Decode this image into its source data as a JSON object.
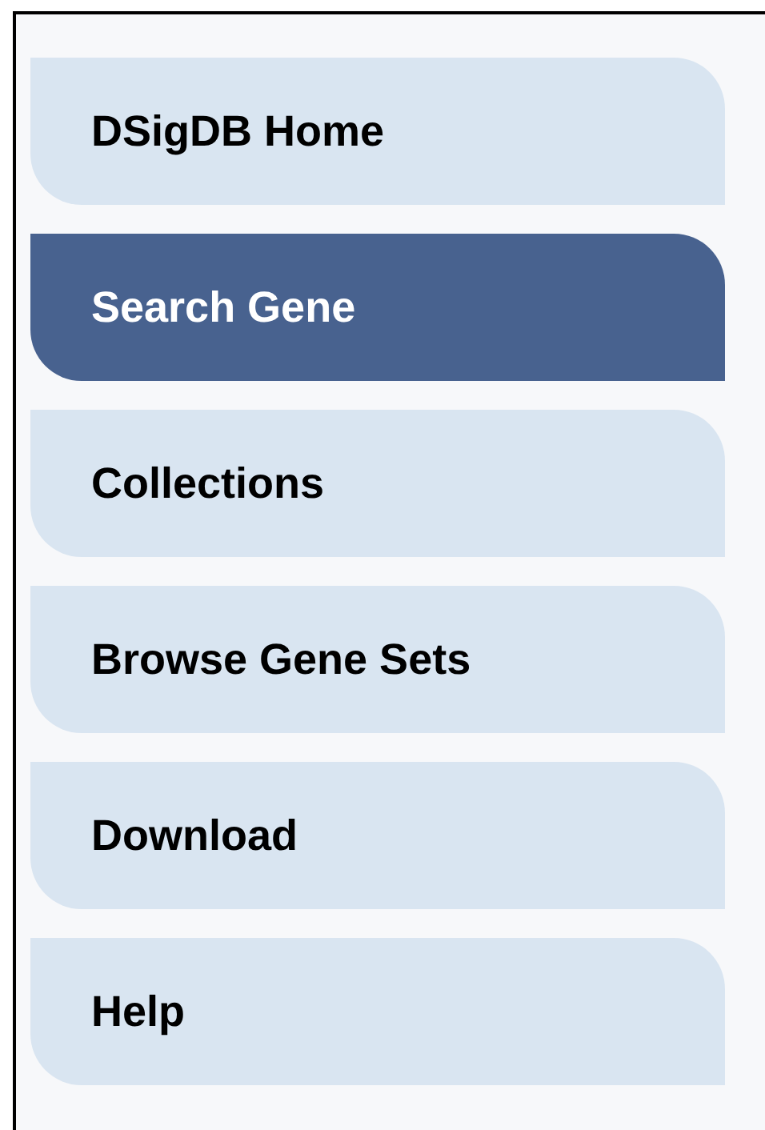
{
  "nav": {
    "items": [
      {
        "label": "DSigDB Home",
        "selected": false
      },
      {
        "label": "Search Gene",
        "selected": true
      },
      {
        "label": "Collections",
        "selected": false
      },
      {
        "label": "Browse Gene Sets",
        "selected": false
      },
      {
        "label": "Download",
        "selected": false
      },
      {
        "label": "Help",
        "selected": false
      }
    ]
  }
}
